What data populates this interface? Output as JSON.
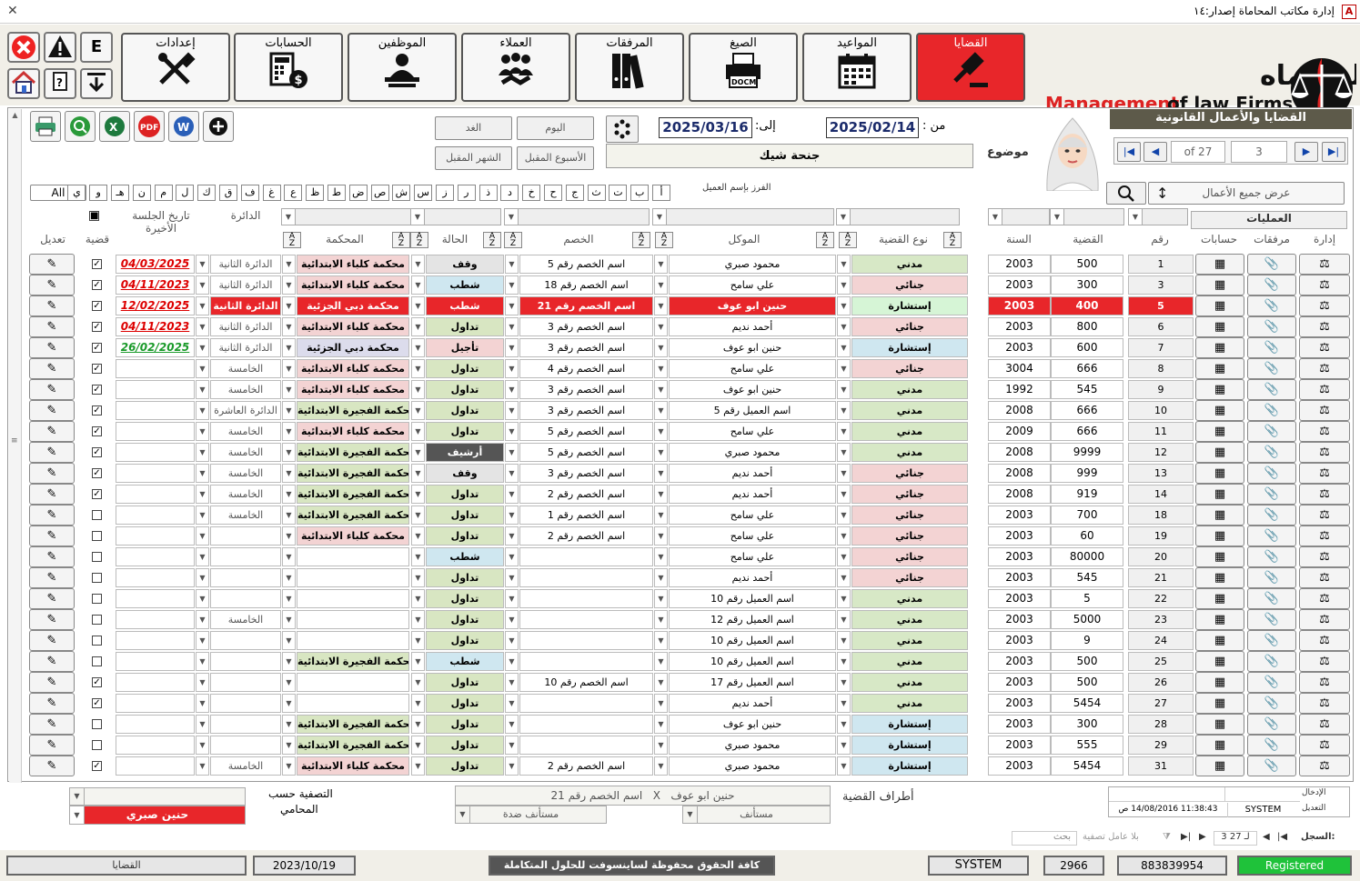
{
  "window": {
    "title": "إدارة مكاتب المحاماة إصدار:١٤",
    "app_icon": "A"
  },
  "toolbar": {
    "e_label": "E"
  },
  "nav": [
    {
      "label": "إعدادات",
      "icon": "tools-icon",
      "active": false
    },
    {
      "label": "الحسابات",
      "icon": "calculator-money-icon",
      "active": false
    },
    {
      "label": "الموظفين",
      "icon": "employee-desk-icon",
      "active": false
    },
    {
      "label": "العملاء",
      "icon": "clients-handshake-icon",
      "active": false
    },
    {
      "label": "المرفقات",
      "icon": "binders-icon",
      "active": false
    },
    {
      "label": "الصيغ",
      "icon": "printer-docm-icon",
      "active": false
    },
    {
      "label": "المواعيد",
      "icon": "calendar-icon",
      "active": false
    },
    {
      "label": "القضايا",
      "icon": "gavel-icon",
      "active": true
    }
  ],
  "logo": {
    "arabic": "إدارة مكاتب المحاماه",
    "english_red": "Management",
    "english_dark": "of law Firms"
  },
  "docm_label": "DOCM",
  "panel": {
    "title": "القضايا والأعمال القانونية"
  },
  "nav_record": {
    "of_label": "of 27",
    "current": "3"
  },
  "show_all": "عرض جميع الأعمال",
  "date_filter": {
    "from_label": "من :",
    "from": "2025/02/14",
    "to_label": "إلى:",
    "to": "2025/03/16"
  },
  "quick_dates": {
    "tomorrow": "الغد",
    "today": "اليوم",
    "next_week": "الأسبوع المقبل",
    "next_month": "الشهر المقبل"
  },
  "subject": {
    "label": "موضوع",
    "value": "جنحة شيك"
  },
  "sort_by_client": "الفرز بإسم العميل",
  "letters": [
    "أ",
    "ب",
    "ت",
    "ث",
    "ج",
    "ح",
    "خ",
    "د",
    "ذ",
    "ر",
    "ز",
    "س",
    "ش",
    "ص",
    "ض",
    "ط",
    "ظ",
    "ع",
    "غ",
    "ف",
    "ق",
    "ك",
    "ل",
    "م",
    "ن",
    "هـ",
    "و",
    "ي"
  ],
  "all_label": "All",
  "columns": {
    "operations": "العمليات",
    "manage": "إدارة",
    "attachments": "مرفقات",
    "accounts": "حسابات",
    "num": "رقم",
    "case": "القضية",
    "year": "السنة",
    "case_type": "نوع القضية",
    "client": "الموكل",
    "opponent": "الخصم",
    "status": "الحالة",
    "court": "المحكمة",
    "circuit": "الدائرة",
    "last_session": "تاريخ الجلسة الأخيرة",
    "case_flag": "قضية",
    "edit": "تعديل"
  },
  "colors": {
    "madani": "#d7e8c6",
    "jinai": "#f3d3d3",
    "istishara": "#cfe7f0",
    "red": "#e8262a",
    "court_green": "#d8e6c2",
    "court_pink": "#f3d3d3",
    "court_lav": "#dcdcec",
    "status_green": "#d8e6c2",
    "status_blue": "#cfe7f0",
    "status_pink": "#f3d3d3",
    "status_gray": "#555555"
  },
  "rows": [
    {
      "num": "1",
      "case": "500",
      "year": "2003",
      "type": "مدني",
      "tc": "madani",
      "client": "محمود صبري",
      "opponent": "اسم الخصم رقم 5",
      "status": "وقف",
      "sc": "status_gray_light",
      "court": "محكمة كلباء الابتدائية",
      "cc": "court_pink",
      "circuit": "الدائرة الثانية",
      "date": "04/03/2025",
      "dc": "red",
      "chk": true,
      "sel": false
    },
    {
      "num": "3",
      "case": "300",
      "year": "2003",
      "type": "جنائي",
      "tc": "jinai",
      "client": "علي سامح",
      "opponent": "اسم الخصم رقم 18",
      "status": "شطب",
      "sc": "status_blue",
      "court": "محكمة كلباء الابتدائية",
      "cc": "court_pink",
      "circuit": "الدائرة الثانية",
      "date": "04/11/2023",
      "dc": "red",
      "chk": true,
      "sel": false
    },
    {
      "num": "5",
      "case": "400",
      "year": "2003",
      "type": "إستشارة",
      "tc": "istishara_sel",
      "client": "حنين ابو عوف",
      "opponent": "اسم الخصم رقم 21",
      "status": "شطب",
      "sc": "red",
      "court": "محكمة دبي الجزئية",
      "cc": "red",
      "circuit": "الدائرة الثانية",
      "date": "12/02/2025",
      "dc": "red",
      "chk": true,
      "sel": true
    },
    {
      "num": "6",
      "case": "800",
      "year": "2003",
      "type": "جنائي",
      "tc": "jinai",
      "client": "أحمد نديم",
      "opponent": "اسم الخصم رقم 3",
      "status": "تداول",
      "sc": "status_green",
      "court": "محكمة كلباء الابتدائية",
      "cc": "court_pink",
      "circuit": "الدائرة الثانية",
      "date": "04/11/2023",
      "dc": "red",
      "chk": true,
      "sel": false
    },
    {
      "num": "7",
      "case": "600",
      "year": "2003",
      "type": "إستشارة",
      "tc": "istishara",
      "client": "حنين ابو عوف",
      "opponent": "اسم الخصم رقم 3",
      "status": "تأجيل",
      "sc": "status_pink",
      "court": "محكمة دبي الجزئية",
      "cc": "court_lav",
      "circuit": "الدائرة الثانية",
      "date": "26/02/2025",
      "dc": "green",
      "chk": true,
      "sel": false
    },
    {
      "num": "8",
      "case": "666",
      "year": "3004",
      "type": "جنائي",
      "tc": "jinai",
      "client": "علي سامح",
      "opponent": "اسم الخصم رقم 4",
      "status": "تداول",
      "sc": "status_green",
      "court": "محكمة كلباء الابتدائية",
      "cc": "court_pink",
      "circuit": "الخامسة",
      "date": "",
      "dc": "",
      "chk": true,
      "sel": false
    },
    {
      "num": "9",
      "case": "545",
      "year": "1992",
      "type": "مدني",
      "tc": "madani",
      "client": "حنين ابو عوف",
      "opponent": "اسم الخصم رقم 3",
      "status": "تداول",
      "sc": "status_green",
      "court": "محكمة كلباء الابتدائية",
      "cc": "court_pink",
      "circuit": "الخامسة",
      "date": "",
      "dc": "",
      "chk": true,
      "sel": false
    },
    {
      "num": "10",
      "case": "666",
      "year": "2008",
      "type": "مدني",
      "tc": "madani",
      "client": "اسم العميل رقم 5",
      "opponent": "اسم الخصم رقم 3",
      "status": "تداول",
      "sc": "status_green",
      "court": "محكمة الفجيرة الابتدائية",
      "cc": "court_green",
      "circuit": "الدائرة العاشرة",
      "date": "",
      "dc": "",
      "chk": true,
      "sel": false
    },
    {
      "num": "11",
      "case": "666",
      "year": "2009",
      "type": "مدني",
      "tc": "madani",
      "client": "علي سامح",
      "opponent": "اسم الخصم رقم 5",
      "status": "تداول",
      "sc": "status_green",
      "court": "محكمة كلباء الابتدائية",
      "cc": "court_pink",
      "circuit": "الخامسة",
      "date": "",
      "dc": "",
      "chk": true,
      "sel": false
    },
    {
      "num": "12",
      "case": "9999",
      "year": "2008",
      "type": "مدني",
      "tc": "madani",
      "client": "محمود صبري",
      "opponent": "اسم الخصم رقم 5",
      "status": "أرشيف",
      "sc": "status_gray",
      "court": "محكمة الفجيرة الابتدائية",
      "cc": "court_green",
      "circuit": "الخامسة",
      "date": "",
      "dc": "",
      "chk": true,
      "sel": false
    },
    {
      "num": "13",
      "case": "999",
      "year": "2008",
      "type": "جنائي",
      "tc": "jinai",
      "client": "أحمد نديم",
      "opponent": "اسم الخصم رقم 3",
      "status": "وقف",
      "sc": "status_gray_light",
      "court": "محكمة الفجيرة الابتدائية",
      "cc": "court_green",
      "circuit": "الخامسة",
      "date": "",
      "dc": "",
      "chk": true,
      "sel": false
    },
    {
      "num": "14",
      "case": "919",
      "year": "2008",
      "type": "جنائي",
      "tc": "jinai",
      "client": "أحمد نديم",
      "opponent": "اسم الخصم رقم 2",
      "status": "تداول",
      "sc": "status_green",
      "court": "محكمة الفجيرة الابتدائية",
      "cc": "court_green",
      "circuit": "الخامسة",
      "date": "",
      "dc": "",
      "chk": true,
      "sel": false
    },
    {
      "num": "18",
      "case": "700",
      "year": "2003",
      "type": "جنائي",
      "tc": "jinai",
      "client": "علي سامح",
      "opponent": "اسم الخصم رقم 1",
      "status": "تداول",
      "sc": "status_green",
      "court": "محكمة الفجيرة الابتدائية",
      "cc": "court_green",
      "circuit": "الخامسة",
      "date": "",
      "dc": "",
      "chk": false,
      "sel": false
    },
    {
      "num": "19",
      "case": "60",
      "year": "2003",
      "type": "جنائي",
      "tc": "jinai",
      "client": "علي سامح",
      "opponent": "اسم الخصم رقم 2",
      "status": "تداول",
      "sc": "status_green",
      "court": "محكمة كلباء الابتدائية",
      "cc": "court_pink",
      "circuit": "",
      "date": "",
      "dc": "",
      "chk": false,
      "sel": false
    },
    {
      "num": "20",
      "case": "80000",
      "year": "2003",
      "type": "جنائي",
      "tc": "jinai",
      "client": "علي سامح",
      "opponent": "",
      "status": "شطب",
      "sc": "status_blue",
      "court": "",
      "cc": "",
      "circuit": "",
      "date": "",
      "dc": "",
      "chk": false,
      "sel": false
    },
    {
      "num": "21",
      "case": "545",
      "year": "2003",
      "type": "جنائي",
      "tc": "jinai",
      "client": "أحمد نديم",
      "opponent": "",
      "status": "تداول",
      "sc": "status_green",
      "court": "",
      "cc": "",
      "circuit": "",
      "date": "",
      "dc": "",
      "chk": false,
      "sel": false
    },
    {
      "num": "22",
      "case": "5",
      "year": "2003",
      "type": "مدني",
      "tc": "madani",
      "client": "اسم العميل رقم 10",
      "opponent": "",
      "status": "تداول",
      "sc": "status_green",
      "court": "",
      "cc": "",
      "circuit": "",
      "date": "",
      "dc": "",
      "chk": false,
      "sel": false
    },
    {
      "num": "23",
      "case": "5000",
      "year": "2003",
      "type": "مدني",
      "tc": "madani",
      "client": "اسم العميل رقم 12",
      "opponent": "",
      "status": "تداول",
      "sc": "status_green",
      "court": "",
      "cc": "",
      "circuit": "الخامسة",
      "date": "",
      "dc": "",
      "chk": false,
      "sel": false
    },
    {
      "num": "24",
      "case": "9",
      "year": "2003",
      "type": "مدني",
      "tc": "madani",
      "client": "اسم العميل رقم 10",
      "opponent": "",
      "status": "تداول",
      "sc": "status_green",
      "court": "",
      "cc": "",
      "circuit": "",
      "date": "",
      "dc": "",
      "chk": false,
      "sel": false
    },
    {
      "num": "25",
      "case": "500",
      "year": "2003",
      "type": "مدني",
      "tc": "madani",
      "client": "اسم العميل رقم 10",
      "opponent": "",
      "status": "شطب",
      "sc": "status_blue",
      "court": "محكمة الفجيرة الابتدائية",
      "cc": "court_green",
      "circuit": "",
      "date": "",
      "dc": "",
      "chk": false,
      "sel": false
    },
    {
      "num": "26",
      "case": "500",
      "year": "2003",
      "type": "مدني",
      "tc": "madani",
      "client": "اسم العميل رقم 17",
      "opponent": "اسم الخصم رقم 10",
      "status": "تداول",
      "sc": "status_green",
      "court": "",
      "cc": "",
      "circuit": "",
      "date": "",
      "dc": "",
      "chk": true,
      "sel": false
    },
    {
      "num": "27",
      "case": "5454",
      "year": "2003",
      "type": "مدني",
      "tc": "madani",
      "client": "أحمد نديم",
      "opponent": "",
      "status": "تداول",
      "sc": "status_green",
      "court": "",
      "cc": "",
      "circuit": "",
      "date": "",
      "dc": "",
      "chk": true,
      "sel": false
    },
    {
      "num": "28",
      "case": "300",
      "year": "2003",
      "type": "إستشارة",
      "tc": "istishara",
      "client": "حنين ابو عوف",
      "opponent": "",
      "status": "تداول",
      "sc": "status_green",
      "court": "محكمة الفجيرة الابتدائية",
      "cc": "court_green",
      "circuit": "",
      "date": "",
      "dc": "",
      "chk": false,
      "sel": false
    },
    {
      "num": "29",
      "case": "555",
      "year": "2003",
      "type": "إستشارة",
      "tc": "istishara",
      "client": "محمود صبري",
      "opponent": "",
      "status": "تداول",
      "sc": "status_green",
      "court": "محكمة الفجيرة الابتدائية",
      "cc": "court_green",
      "circuit": "",
      "date": "",
      "dc": "",
      "chk": false,
      "sel": false
    },
    {
      "num": "31",
      "case": "5454",
      "year": "2003",
      "type": "إستشارة",
      "tc": "istishara",
      "client": "محمود صبري",
      "opponent": "اسم الخصم رقم 2",
      "status": "تداول",
      "sc": "status_green",
      "court": "محكمة كلباء الابتدائية",
      "cc": "court_pink",
      "circuit": "الخامسة",
      "date": "",
      "dc": "",
      "chk": true,
      "sel": false
    }
  ],
  "bottom": {
    "filter_label": "التصفية حسب",
    "lawyer_label": "المحامي",
    "lawyer_value": "حنين صبري",
    "parties_label": "أطراف القضية",
    "party_client": "حنين ابو عوف",
    "party_sep": "X",
    "party_opponent": "اسم الخصم رقم 21",
    "appellant": "مستأنف",
    "appellee": "مستأنف ضدة",
    "entry_label": "الإدخال",
    "edit_label": "التعديل",
    "entry_user": "SYSTEM",
    "entry_time": "11:38:43 14/08/2016 ص"
  },
  "recordnav": {
    "label": "السجل:",
    "pos": "3 لـ 27",
    "nofilter": "بلا عامل تصفية",
    "search": "بحث"
  },
  "statusbar": {
    "form": "القضايا",
    "date": "2023/10/19",
    "copyright": "كافة الحقوق محفوظة لساينسوفت للحلول المتكاملة",
    "user": "SYSTEM",
    "code": "2966",
    "serial": "883839954",
    "reg": "Registered"
  }
}
